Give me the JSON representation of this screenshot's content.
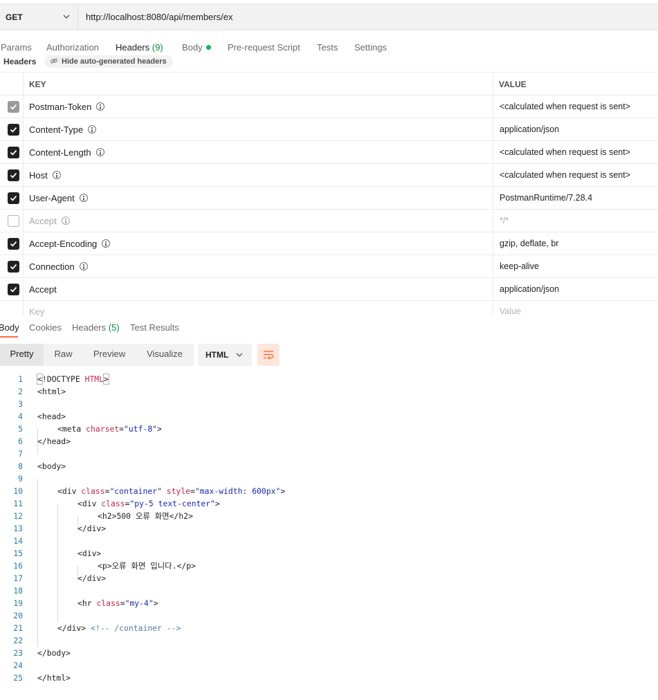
{
  "request": {
    "method": "GET",
    "url": "http://localhost:8080/api/members/ex"
  },
  "request_tabs": [
    {
      "label": "Params"
    },
    {
      "label": "Authorization"
    },
    {
      "label": "Headers",
      "count": "(9)"
    },
    {
      "label": "Body"
    },
    {
      "label": "Pre-request Script"
    },
    {
      "label": "Tests"
    },
    {
      "label": "Settings"
    }
  ],
  "headers_section": {
    "title": "Headers",
    "hide_toggle": "Hide auto-generated headers"
  },
  "headers_table": {
    "columns": [
      "KEY",
      "VALUE"
    ],
    "rows": [
      {
        "key": "Postman-Token",
        "value": "<calculated when request is sent>",
        "state": "locked"
      },
      {
        "key": "Content-Type",
        "value": "application/json",
        "state": "on"
      },
      {
        "key": "Content-Length",
        "value": "<calculated when request is sent>",
        "state": "on"
      },
      {
        "key": "Host",
        "value": "<calculated when request is sent>",
        "state": "on"
      },
      {
        "key": "User-Agent",
        "value": "PostmanRuntime/7.28.4",
        "state": "on"
      },
      {
        "key": "Accept",
        "value": "*/*",
        "state": "off"
      },
      {
        "key": "Accept-Encoding",
        "value": "gzip, deflate, br",
        "state": "on"
      },
      {
        "key": "Connection",
        "value": "keep-alive",
        "state": "on"
      },
      {
        "key": "Accept",
        "value": "application/json",
        "state": "on",
        "user": true
      }
    ],
    "new_row": {
      "key_placeholder": "Key",
      "value_placeholder": "Value"
    }
  },
  "response_tabs": [
    {
      "label": "Body"
    },
    {
      "label": "Cookies"
    },
    {
      "label": "Headers",
      "count": "(5)"
    },
    {
      "label": "Test Results"
    }
  ],
  "view_modes": [
    "Pretty",
    "Raw",
    "Preview",
    "Visualize"
  ],
  "language": "HTML",
  "code_lines": [
    "1",
    "2",
    "3",
    "4",
    "5",
    "6",
    "7",
    "8",
    "9",
    "10",
    "11",
    "12",
    "13",
    "14",
    "15",
    "16",
    "17",
    "18",
    "19",
    "20",
    "21",
    "22",
    "23",
    "24",
    "25"
  ],
  "code": {
    "l1a": "<",
    "l1b": "!DOCTYPE ",
    "l1c": "HTML",
    "l1d": ">",
    "l2": "<html>",
    "l4": "<head>",
    "l5a": "<meta ",
    "l5b": "charset",
    "l5c": "=",
    "l5d": "\"utf-8\"",
    "l5e": ">",
    "l6": "</head>",
    "l8": "<body>",
    "l10a": "<div ",
    "l10b": "class",
    "l10c": "=",
    "l10d": "\"container\"",
    "l10e": " ",
    "l10f": "style",
    "l10g": "=",
    "l10h": "\"max-width: 600px\"",
    "l10i": ">",
    "l11a": "<div ",
    "l11b": "class",
    "l11c": "=",
    "l11d": "\"py-5 text-center\"",
    "l11e": ">",
    "l12a": "<h2>",
    "l12b": "500 오류 화면",
    "l12c": "</h2>",
    "l13": "</div>",
    "l15": "<div>",
    "l16a": "<p>",
    "l16b": "오류 화면 입니다.",
    "l16c": "</p>",
    "l17": "</div>",
    "l19a": "<hr ",
    "l19b": "class",
    "l19c": "=",
    "l19d": "\"my-4\"",
    "l19e": ">",
    "l21a": "</div> ",
    "l21b": "<!-- /container -->",
    "l23": "</body>",
    "l25": "</html>"
  },
  "colors": {
    "accent": "#ff6c37",
    "count_green": "#0c8a3f",
    "body_dot": "#0cbb52"
  }
}
